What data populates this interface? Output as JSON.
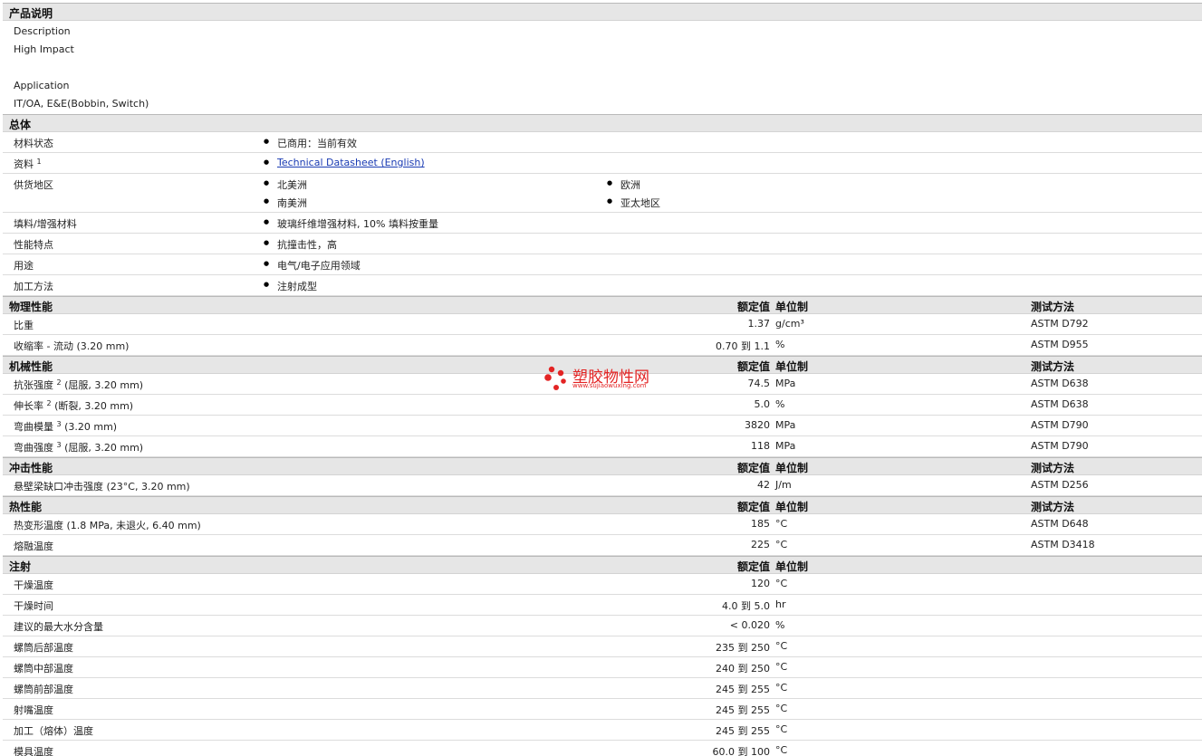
{
  "product_description": {
    "title": "产品说明",
    "description_label": "Description",
    "description_value": "High Impact",
    "application_label": "Application",
    "application_value": "IT/OA, E&E(Bobbin, Switch)"
  },
  "general": {
    "title": "总体",
    "rows": [
      {
        "label": "材料状态",
        "items": [
          "已商用：当前有效"
        ]
      },
      {
        "label": "资料",
        "sup": "1",
        "items": [
          "Technical Datasheet (English)"
        ]
      },
      {
        "label": "供货地区",
        "items": [
          "北美洲",
          "欧洲",
          "南美洲",
          "亚太地区"
        ]
      },
      {
        "label": "填料/增强材料",
        "items": [
          "玻璃纤维增强材料, 10% 填料按重量"
        ]
      },
      {
        "label": "性能特点",
        "items": [
          "抗撞击性，高"
        ]
      },
      {
        "label": "用途",
        "items": [
          "电气/电子应用领域"
        ]
      },
      {
        "label": "加工方法",
        "items": [
          "注射成型"
        ]
      }
    ]
  },
  "headers": {
    "value": "额定值",
    "unit": "单位制",
    "method": "测试方法"
  },
  "physical": {
    "title": "物理性能",
    "rows": [
      {
        "label": "比重",
        "value": "1.37",
        "unit": "g/cm³",
        "method": "ASTM D792"
      },
      {
        "label": "收缩率 - 流动  (3.20 mm)",
        "value": "0.70 到  1.1",
        "unit": "%",
        "method": "ASTM D955"
      }
    ]
  },
  "mechanical": {
    "title": "机械性能",
    "rows": [
      {
        "label": "抗张强度",
        "sup": "2",
        "suffix": " (屈服, 3.20 mm)",
        "value": "74.5",
        "unit": "MPa",
        "method": "ASTM D638"
      },
      {
        "label": "伸长率",
        "sup": "2",
        "suffix": " (断裂, 3.20 mm)",
        "value": "5.0",
        "unit": "%",
        "method": "ASTM D638"
      },
      {
        "label": "弯曲模量",
        "sup": "3",
        "suffix": " (3.20 mm)",
        "value": "3820",
        "unit": "MPa",
        "method": "ASTM D790"
      },
      {
        "label": "弯曲强度",
        "sup": "3",
        "suffix": " (屈服, 3.20 mm)",
        "value": "118",
        "unit": "MPa",
        "method": "ASTM D790"
      }
    ]
  },
  "impact": {
    "title": "冲击性能",
    "rows": [
      {
        "label": "悬壁梁缺口冲击强度  (23°C, 3.20 mm)",
        "value": "42",
        "unit": "J/m",
        "method": "ASTM D256"
      }
    ]
  },
  "thermal": {
    "title": "热性能",
    "rows": [
      {
        "label": "热变形温度  (1.8 MPa, 未退火, 6.40 mm)",
        "value": "185",
        "unit": "°C",
        "method": "ASTM D648"
      },
      {
        "label": "熔融温度",
        "value": "225",
        "unit": "°C",
        "method": "ASTM D3418"
      }
    ]
  },
  "injection": {
    "title": "注射",
    "rows": [
      {
        "label": "干燥温度",
        "value": "120",
        "unit": "°C"
      },
      {
        "label": "干燥时间",
        "value": "4.0 到  5.0",
        "unit": "hr"
      },
      {
        "label": "建议的最大水分含量",
        "value": "< 0.020",
        "unit": "%"
      },
      {
        "label": "螺筒后部温度",
        "value": "235 到  250",
        "unit": "°C"
      },
      {
        "label": "螺筒中部温度",
        "value": "240 到  250",
        "unit": "°C"
      },
      {
        "label": "螺筒前部温度",
        "value": "245 到  255",
        "unit": "°C"
      },
      {
        "label": "射嘴温度",
        "value": "245 到  255",
        "unit": "°C"
      },
      {
        "label": "加工（熔体）温度",
        "value": "245 到  255",
        "unit": "°C"
      },
      {
        "label": "模具温度",
        "value": "60.0 到  100",
        "unit": "°C"
      }
    ]
  },
  "watermark": {
    "text": "塑胶物性网",
    "url": "www.sujiaowuxing.com",
    "color": "#e32424"
  }
}
